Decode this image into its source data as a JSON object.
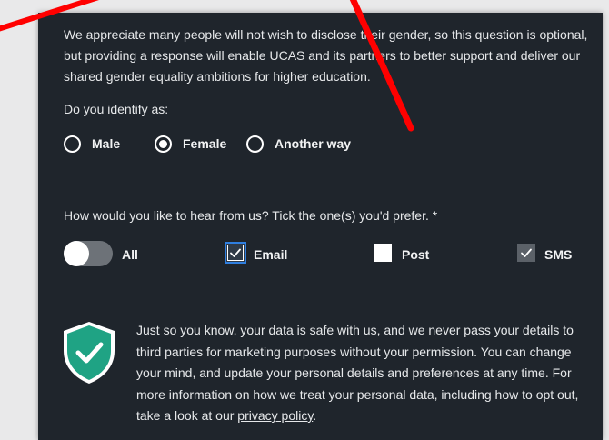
{
  "gender_section": {
    "intro": "We appreciate many people will not wish to disclose their gender, so this question is optional, but providing a response will enable UCAS and its partners to better support and deliver our shared gender equality ambitions for higher education.",
    "question": "Do you identify as:",
    "options": [
      {
        "label": "Male",
        "selected": false
      },
      {
        "label": "Female",
        "selected": true
      },
      {
        "label": "Another way",
        "selected": false
      }
    ]
  },
  "contact_section": {
    "question": "How would you like to hear from us? Tick the one(s) you'd prefer. *",
    "toggle_label": "All",
    "toggle_on": false,
    "options": [
      {
        "label": "Email",
        "checked": true
      },
      {
        "label": "Post",
        "checked": false
      },
      {
        "label": "SMS",
        "checked": true
      }
    ]
  },
  "privacy": {
    "text": "Just so you know, your data is safe with us, and we never pass your details to third parties for marketing purposes without your permission. You can change your mind, and update your personal details and preferences at any time. For more information on how we treat your personal data, including how to opt out, take a look at our ",
    "link_text": "privacy policy",
    "trailing": "."
  },
  "colors": {
    "panel_bg": "#1f252c",
    "shield_green": "#1fa384",
    "focus_blue": "#2f7fe0",
    "annotation_red": "#ff0000"
  }
}
